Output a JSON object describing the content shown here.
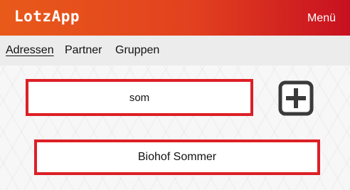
{
  "header": {
    "title": "LotzApp",
    "menu_label": "Menü"
  },
  "nav": {
    "tabs": [
      {
        "label": "Adressen",
        "active": true
      },
      {
        "label": "Partner",
        "active": false
      },
      {
        "label": "Gruppen",
        "active": false
      }
    ]
  },
  "search": {
    "value": "som"
  },
  "add_button": {
    "icon": "plus-square-icon"
  },
  "results": [
    {
      "label": "Biohof Sommer"
    }
  ],
  "colors": {
    "header_start": "#e85a1a",
    "header_end": "#c81020",
    "highlight_border": "#dd1f26",
    "icon": "#3a3a3a"
  }
}
